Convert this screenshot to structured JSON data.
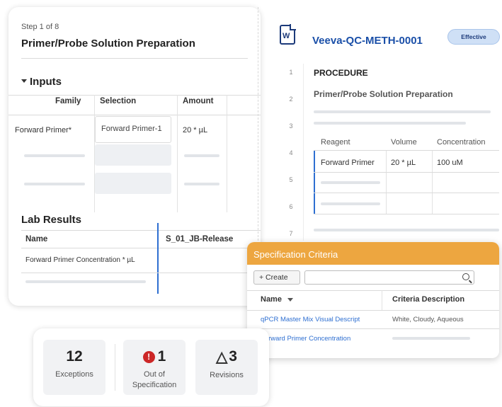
{
  "left_panel": {
    "step": "Step 1 of 8",
    "title": "Primer/Probe Solution Preparation",
    "inputs": {
      "heading": "Inputs",
      "headers": [
        "Family",
        "Selection",
        "Amount"
      ],
      "row": {
        "family": "Forward Primer*",
        "selection": "Forward Primer-1",
        "amount": "20 * µL"
      }
    },
    "lab_results": {
      "heading": "Lab Results",
      "headers": [
        "Name",
        "S_01_JB-Release"
      ],
      "row": {
        "name": "Forward Primer Concentration * µL"
      }
    }
  },
  "document": {
    "icon": "document-w-icon",
    "icon_letter": "W",
    "id": "Veeva-QC-METH-0001",
    "status": "Effective",
    "line_numbers": [
      "1",
      "2",
      "3",
      "4",
      "5",
      "6",
      "7"
    ],
    "procedure_heading": "PROCEDURE",
    "procedure_subheading": "Primer/Probe Solution Preparation",
    "reagent_table": {
      "headers": [
        "Reagent",
        "Volume",
        "Concentration"
      ],
      "row": {
        "reagent": "Forward Primer",
        "volume": "20 * µL",
        "concentration": "100 uM"
      }
    }
  },
  "spec_criteria": {
    "title": "Specification Criteria",
    "create_label": "+ Create",
    "search_placeholder": "",
    "headers": {
      "name": "Name",
      "description": "Criteria Description"
    },
    "rows": [
      {
        "name": "qPCR Master Mix Visual Descript",
        "description": "White, Cloudy, Aqueous"
      },
      {
        "name": "Forward Primer Concentration",
        "description": ""
      }
    ],
    "accent_color": "#eda640"
  },
  "stats": [
    {
      "value": "12",
      "label": "Exceptions",
      "icon": ""
    },
    {
      "value": "1",
      "label": "Out of Specification",
      "icon": "error-icon"
    },
    {
      "value": "3",
      "label": "Revisions",
      "icon": "triangle-icon"
    }
  ],
  "colors": {
    "link": "#2e6fd1",
    "brand_dark": "#1c3a7a",
    "error": "#cc2727"
  }
}
